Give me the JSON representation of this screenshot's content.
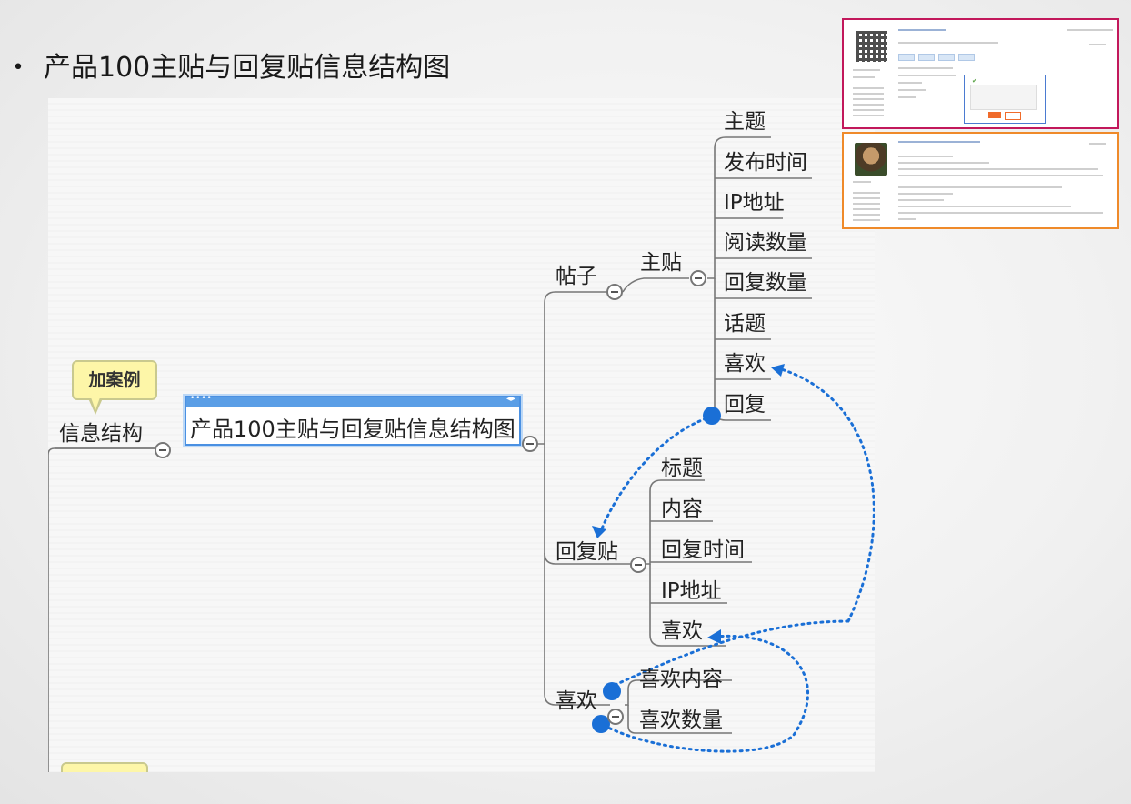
{
  "slide": {
    "bullet": "•",
    "title": "产品100主贴与回复贴信息结构图"
  },
  "mindmap": {
    "left_root": "信息结构",
    "callout": "加案例",
    "central": "产品100主贴与回复贴信息结构图",
    "branches": {
      "post": {
        "label": "帖子",
        "main": {
          "label": "主贴",
          "children": [
            "主题",
            "发布时间",
            "IP地址",
            "阅读数量",
            "回复数量",
            "话题",
            "喜欢",
            "回复"
          ]
        }
      },
      "reply": {
        "label": "回复贴",
        "children": [
          "标题",
          "内容",
          "回复时间",
          "IP地址",
          "喜欢"
        ]
      },
      "like": {
        "label": "喜欢",
        "children": [
          "喜欢内容",
          "喜欢数量"
        ]
      }
    },
    "colors": {
      "relation_line": "#1a6fd6",
      "central_border": "#4a90e2",
      "callout_fill": "#fdf6a8",
      "branch_line": "#777777"
    }
  },
  "thumbnails": {
    "post_thumb": {
      "border_color": "#c2185b"
    },
    "reply_thumb": {
      "border_color": "#ef8a2a"
    }
  }
}
